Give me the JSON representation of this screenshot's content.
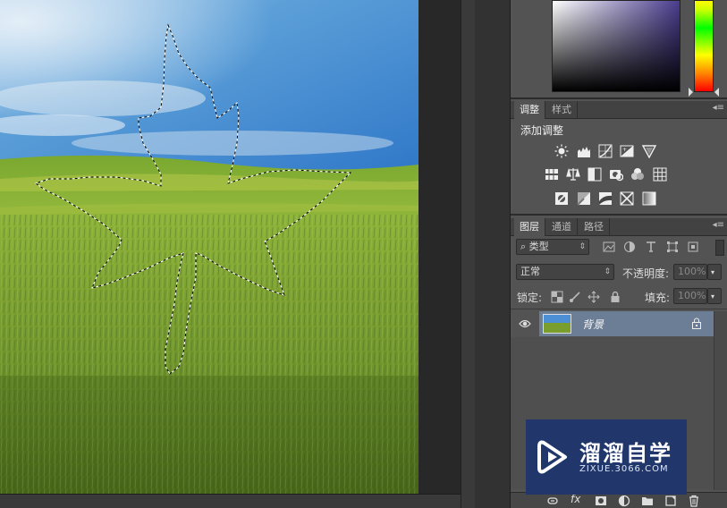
{
  "adjustments_panel": {
    "tabs": [
      {
        "label": "调整",
        "active": true
      },
      {
        "label": "样式",
        "active": false
      }
    ],
    "title": "添加调整",
    "icons_row1": [
      "brightness-icon",
      "levels-icon",
      "curves-icon",
      "exposure-icon",
      "vibrance-icon"
    ],
    "icons_row2": [
      "hue-saturation-icon",
      "color-balance-icon",
      "black-white-icon",
      "photo-filter-icon",
      "channel-mixer-icon",
      "color-lookup-icon"
    ],
    "icons_row3": [
      "invert-icon",
      "posterize-icon",
      "threshold-icon",
      "selective-color-icon",
      "gradient-map-icon"
    ]
  },
  "layers_panel": {
    "tabs": [
      {
        "label": "图层",
        "active": true
      },
      {
        "label": "通道",
        "active": false
      },
      {
        "label": "路径",
        "active": false
      }
    ],
    "filter_kind": "类型",
    "blend_mode": "正常",
    "opacity_label": "不透明度:",
    "opacity_value": "100%",
    "lock_label": "锁定:",
    "fill_label": "填充:",
    "fill_value": "100%",
    "layers": [
      {
        "name": "背景",
        "visible": true,
        "locked": true,
        "selected": true
      }
    ],
    "footer_icons": [
      "link-layers-icon",
      "fx-icon",
      "mask-icon",
      "adjustment-layer-icon",
      "group-folder-icon",
      "new-layer-icon",
      "trash-icon"
    ],
    "footer_fx_label": "fx"
  },
  "watermark": {
    "brand": "溜溜自学",
    "url": "ZIXUE.3066.COM"
  },
  "colors": {
    "panel_bg": "#535353",
    "selected_layer": "#6c7e95",
    "watermark_bg": "#21376c"
  }
}
